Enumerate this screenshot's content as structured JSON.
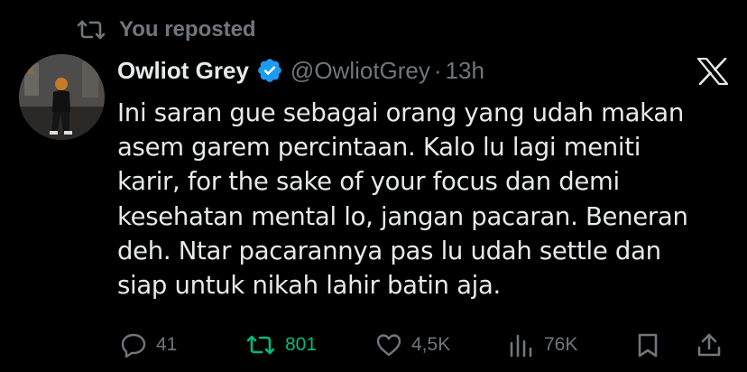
{
  "repost_banner": {
    "text": "You reposted",
    "icon": "repost-icon"
  },
  "tweet": {
    "author_name": "Owliot Grey",
    "verified": true,
    "handle": "@OwliotGrey",
    "separator": "·",
    "time": "13h",
    "text": "Ini saran gue sebagai orang yang udah makan\nasem garem percintaan. Kalo lu lagi meniti\nkarir, for the sake of your focus dan demi\nkesehatan mental lo, jangan pacaran. Beneran\ndeh. Ntar pacarannya pas lu udah settle dan\nsiap untuk nikah lahir batin aja."
  },
  "actions": {
    "replies": "41",
    "reposts": "801",
    "likes": "4,5K",
    "views": "76K"
  },
  "colors": {
    "background": "#000000",
    "text": "#e7e9ea",
    "muted": "#71767b",
    "verified": "#1d9bf0",
    "repost_active": "#00ba7c"
  }
}
